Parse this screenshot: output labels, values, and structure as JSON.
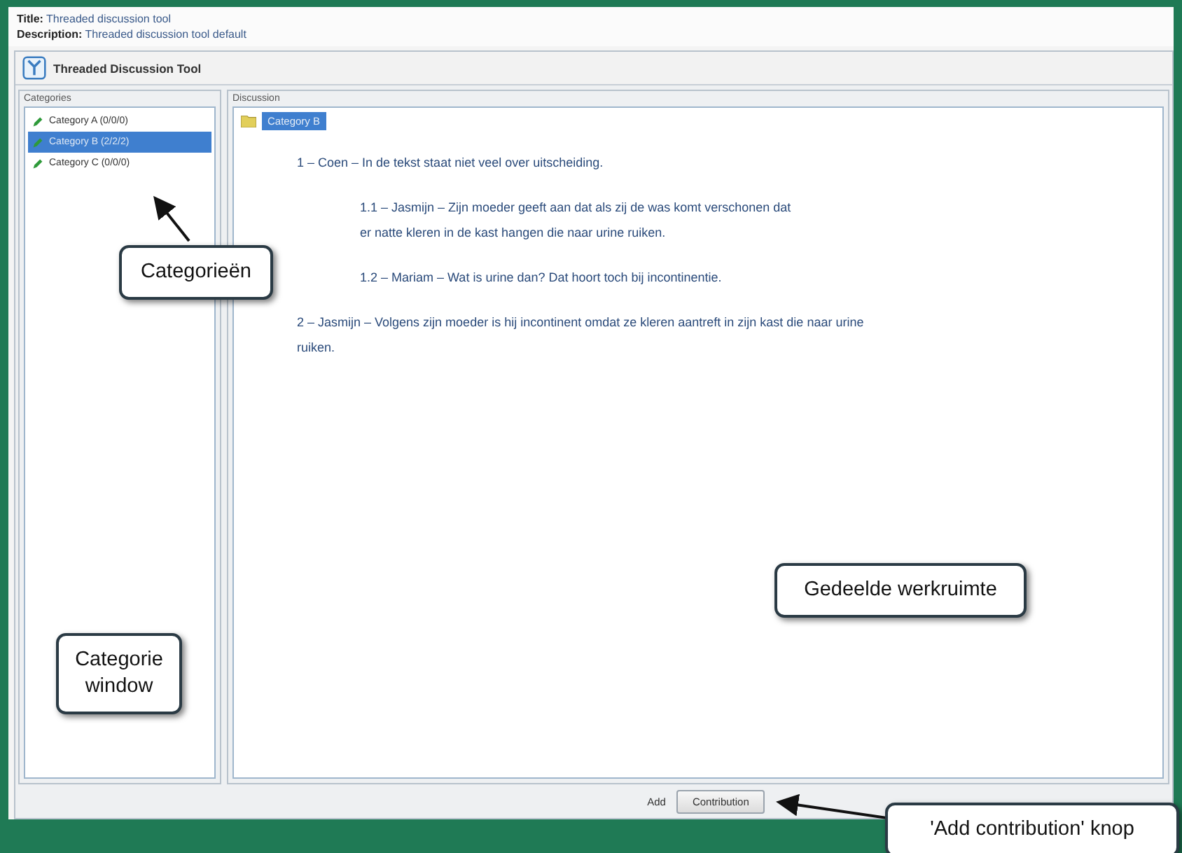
{
  "header": {
    "title_label": "Title:",
    "title": "Threaded discussion tool",
    "description_label": "Description:",
    "description": "Threaded discussion tool default"
  },
  "tool": {
    "title": "Threaded Discussion Tool"
  },
  "categories": {
    "heading": "Categories",
    "items": [
      {
        "label": "Category A (0/0/0)",
        "selected": false
      },
      {
        "label": "Category B (2/2/2)",
        "selected": true
      },
      {
        "label": "Category C (0/0/0)",
        "selected": false
      }
    ]
  },
  "discussion": {
    "heading": "Discussion",
    "node": "Category B",
    "posts": [
      {
        "text": "1 – Coen – In de tekst staat niet veel over uitscheiding.",
        "children": [
          {
            "text": "1.1 – Jasmijn – Zijn moeder geeft aan dat als zij de was komt verschonen dat er natte kleren in de kast hangen die naar urine ruiken."
          },
          {
            "text": "1.2 – Mariam – Wat is urine dan? Dat hoort toch bij incontinentie."
          }
        ]
      },
      {
        "text": "2 – Jasmijn – Volgens zijn moeder is hij incontinent omdat ze kleren aantreft in zijn kast die naar urine ruiken."
      }
    ]
  },
  "footer": {
    "add_label": "Add",
    "button": "Contribution"
  },
  "annotations": [
    {
      "text": "Categorieën"
    },
    {
      "text": "Categorie window"
    },
    {
      "text": "Gedeelde werkruimte"
    },
    {
      "text": "'Add contribution' knop"
    }
  ]
}
